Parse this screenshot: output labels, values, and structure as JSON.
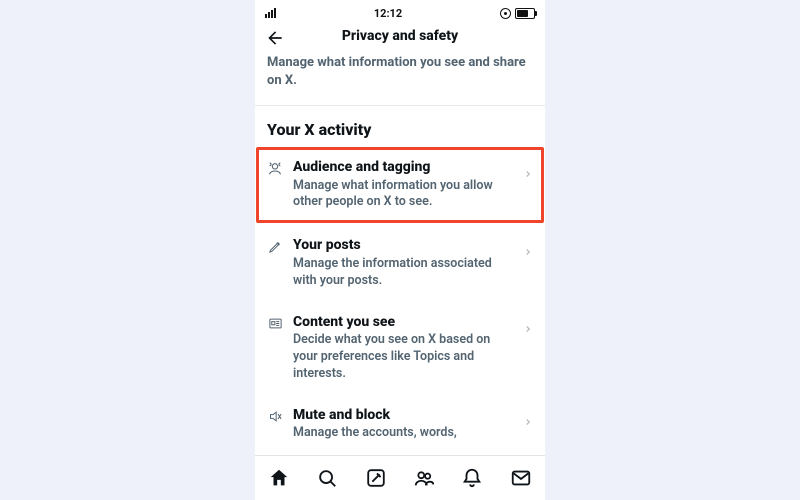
{
  "statusbar": {
    "time": "12:12"
  },
  "header": {
    "title": "Privacy and safety",
    "subtitle": "Manage what information you see and share on X."
  },
  "section": {
    "title": "Your X activity",
    "items": [
      {
        "label": "Audience and tagging",
        "desc": "Manage what information you allow other people on X to see.",
        "highlighted": true
      },
      {
        "label": "Your posts",
        "desc": "Manage the information associated with your posts."
      },
      {
        "label": "Content you see",
        "desc": "Decide what you see on X based on your preferences like Topics and interests."
      },
      {
        "label": "Mute and block",
        "desc": "Manage the accounts, words,"
      }
    ]
  },
  "nav": {
    "items": [
      "home",
      "search",
      "compose",
      "communities",
      "notifications",
      "messages"
    ],
    "active": "home"
  },
  "colors": {
    "highlight": "#f0452c",
    "text": "#0f1419",
    "muted": "#536471"
  }
}
